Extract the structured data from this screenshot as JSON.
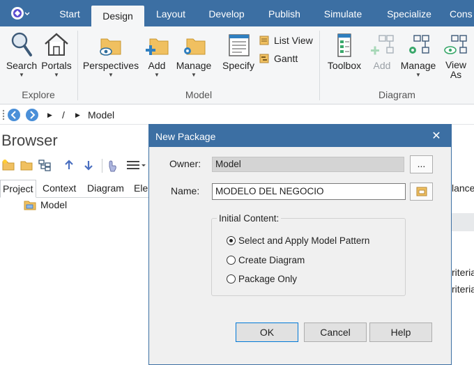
{
  "ribbon_tabs": [
    "Start",
    "Design",
    "Layout",
    "Develop",
    "Publish",
    "Simulate",
    "Specialize",
    "Cons"
  ],
  "active_tab": "Design",
  "ribbon": {
    "search_label": "Search",
    "portals_label": "Portals",
    "explore_group": "Explore",
    "perspectives_label": "Perspectives",
    "add_label": "Add",
    "manage_label": "Manage",
    "specify_label": "Specify",
    "list_view_label": "List View",
    "gantt_label": "Gantt",
    "model_group": "Model",
    "toolbox_label": "Toolbox",
    "diagram_add_label": "Add",
    "diagram_manage_label": "Manage",
    "view_as_label": "View",
    "view_as_label2": "As",
    "diagram_group": "Diagram"
  },
  "navbar": {
    "separator": "/",
    "crumb": "Model"
  },
  "browser": {
    "title": "Browser",
    "tabs": [
      "Project",
      "Context",
      "Diagram",
      "Ele"
    ],
    "active_tab": "Project",
    "tree_root": "Model"
  },
  "background_text": {
    "lance": "lance",
    "criteria1": "riteria",
    "criteria2": "riteria"
  },
  "dialog": {
    "title": "New Package",
    "close_glyph": "✕",
    "owner_label": "Owner:",
    "owner_value": "Model",
    "browse_label": "...",
    "name_label": "Name:",
    "name_value": "MODELO DEL NEGOCIO",
    "initial_content_label": "Initial Content:",
    "options": [
      "Select and Apply Model Pattern",
      "Create Diagram",
      "Package Only"
    ],
    "selected_option": "Select and Apply Model Pattern",
    "ok_label": "OK",
    "cancel_label": "Cancel",
    "help_label": "Help"
  },
  "colors": {
    "title_bar": "#3c6fa3",
    "ribbon_bg": "#f5f6f7",
    "folder": "#f0c060"
  }
}
